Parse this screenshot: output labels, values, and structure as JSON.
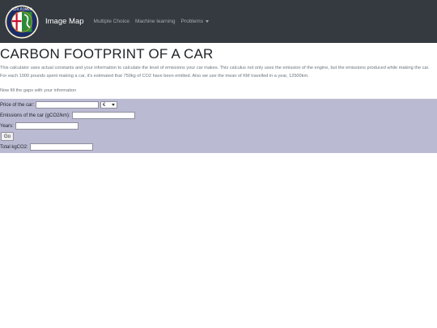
{
  "navbar": {
    "brand": "Image Map",
    "links": [
      "Multiple Choice",
      "Machine learning",
      "Problems"
    ]
  },
  "main": {
    "title": "CARBON FOOTPRINT OF A CAR",
    "description": "This calculator uses actual constants and your information to calculate the level of emissions your car makes. This calculus not only uses the emission of the engine, but the emissions produced while making the car. For each 1000 pounds spent making a car, it's estimated that 750kg of CO2 have been emitted. Also we use the mean of KM travelled in a year, 12500km.",
    "fill_text": "Now fill the gaps with your information"
  },
  "form": {
    "price_label": "Price of the car:",
    "currency_selected": "€",
    "emissions_label": "Emissions of the car (gCO2/km):",
    "years_label": "Years:",
    "go_label": "Go",
    "total_label": "Total kgCO2:"
  },
  "colors": {
    "navbar_bg": "#343a40",
    "form_panel_bg": "#bbbad3"
  }
}
